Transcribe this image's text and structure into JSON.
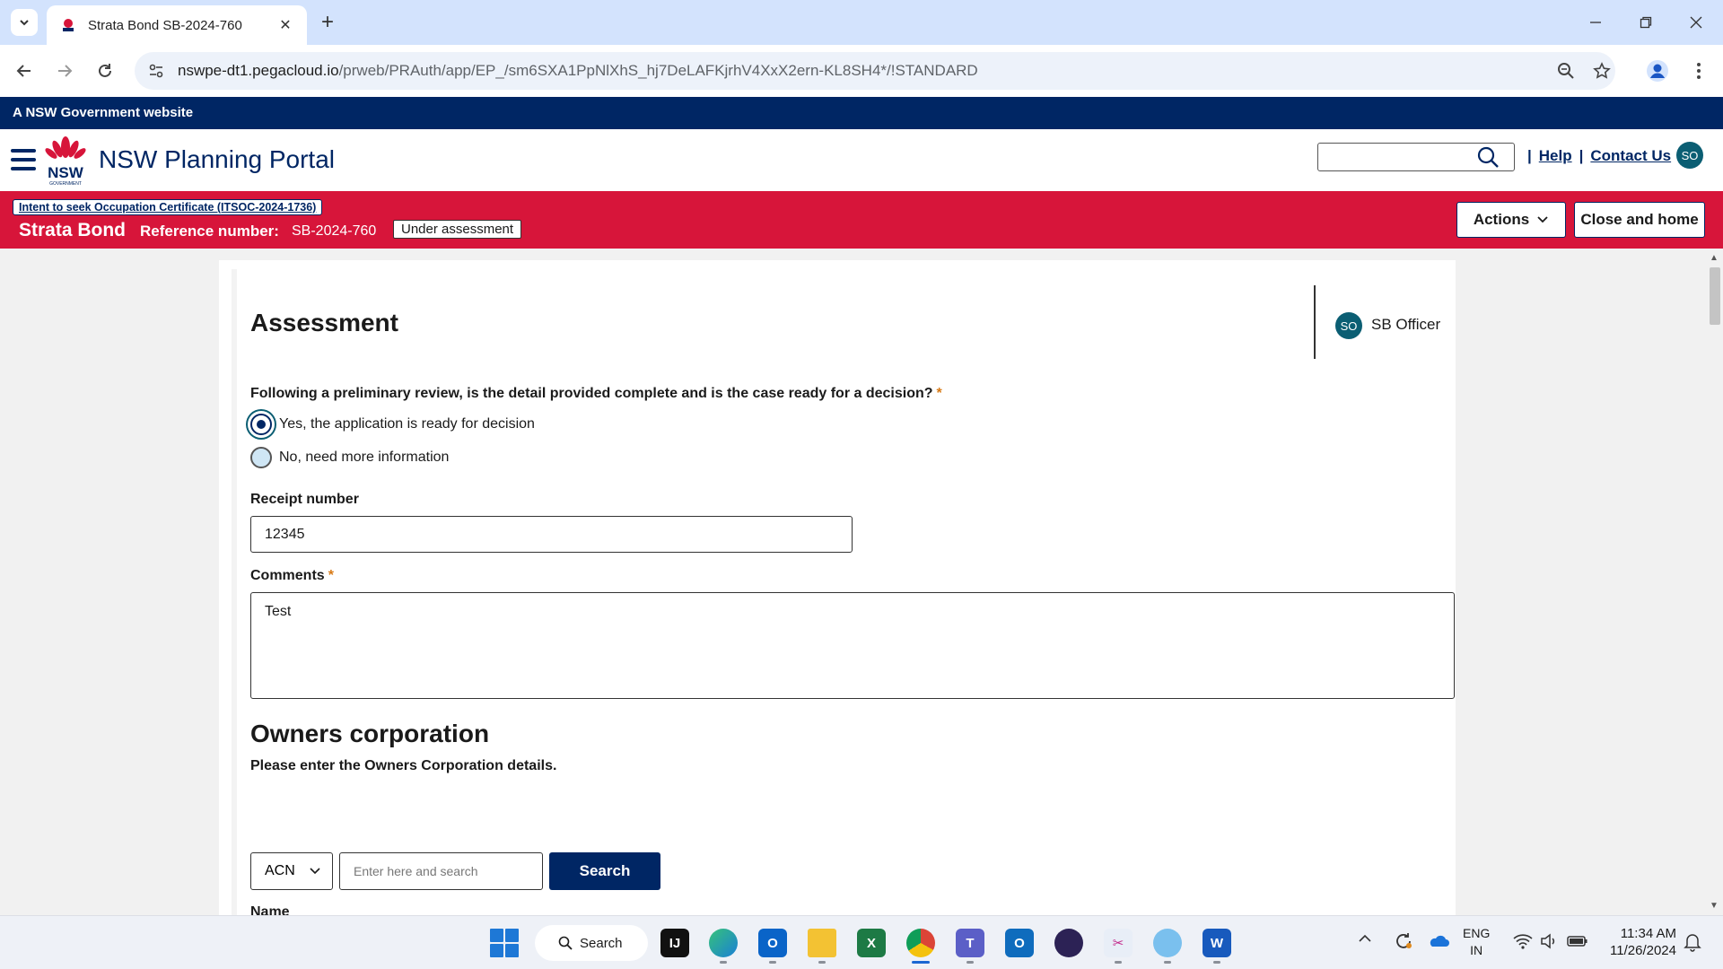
{
  "browser": {
    "tab_title": "Strata Bond SB-2024-760",
    "url_host": "nswpe-dt1.pegacloud.io",
    "url_path": "/prweb/PRAuth/app/EP_/sm6SXA1PpNlXhS_hj7DeLAFKjrhV4XxX2ern-KL8SH4*/!STANDARD"
  },
  "site": {
    "gov_banner": "A NSW Government website",
    "logo_text": "NSW",
    "logo_subtext": "GOVERNMENT",
    "title": "NSW Planning Portal",
    "help_link": "Help",
    "contact_link": "Contact Us",
    "user_initials": "SO",
    "separator": "|"
  },
  "case_header": {
    "parent_case_link": "Intent to seek Occupation Certificate (ITSOC-2024-1736)",
    "case_type": "Strata Bond",
    "ref_label": "Reference number:",
    "ref_value": "SB-2024-760",
    "status": "Under assessment",
    "actions_label": "Actions",
    "close_home_label": "Close and home"
  },
  "assessment": {
    "title": "Assessment",
    "assignee_initials": "SO",
    "assignee_name": "SB Officer",
    "question": "Following a preliminary review, is the detail provided complete and is the case ready for a decision?",
    "required_marker": "*",
    "options": [
      {
        "label": "Yes, the application is ready for decision",
        "selected": true
      },
      {
        "label": "No, need more information",
        "selected": false
      }
    ],
    "receipt_label": "Receipt number",
    "receipt_value": "12345",
    "comments_label": "Comments",
    "comments_value": "Test"
  },
  "owners": {
    "heading": "Owners corporation",
    "subheading": "Please enter the Owners Corporation details.",
    "id_type_selected": "ACN",
    "search_placeholder": "Enter here and search",
    "search_button": "Search",
    "name_label": "Name"
  },
  "taskbar": {
    "search_label": "Search",
    "lang_line1": "ENG",
    "lang_line2": "IN",
    "time": "11:34 AM",
    "date": "11/26/2024",
    "apps": [
      "intellij-icon",
      "edge-icon",
      "outlook-icon",
      "file-explorer-icon",
      "excel-icon",
      "chrome-icon",
      "teams-icon",
      "outlook-new-icon",
      "eclipse-icon",
      "snipping-tool-icon",
      "paint-icon",
      "word-icon"
    ]
  },
  "colors": {
    "nsw_navy": "#002664",
    "nsw_red": "#d7153a",
    "avatar_teal": "#0b5e73",
    "required_orange": "#d87a16"
  }
}
